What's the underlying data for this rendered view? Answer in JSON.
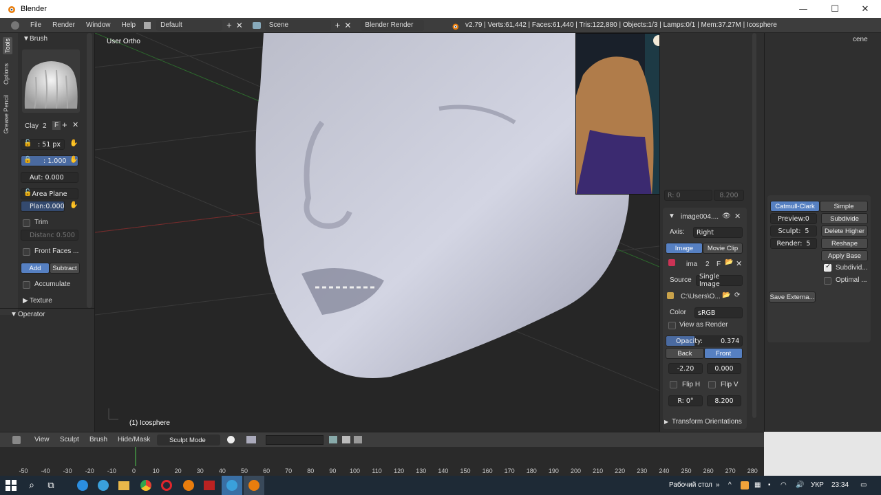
{
  "window": {
    "title": "Blender",
    "minimize": "—",
    "maximize": "☐",
    "close": "✕"
  },
  "infobar": {
    "menus": [
      "File",
      "Render",
      "Window",
      "Help"
    ],
    "layout": "Default",
    "scene": "Scene",
    "engine": "Blender Render",
    "stats": "v2.79 | Verts:61,442 | Faces:61,440 | Tris:122,880 | Objects:1/3 | Lamps:0/1 | Mem:37.27M | Icosphere"
  },
  "toolshelf": {
    "tabs": [
      "Tools",
      "Options",
      "Grease Pencil"
    ],
    "brush_header": "Brush",
    "brush_name": "Clay",
    "brush_users": "2",
    "brush_fake": "F",
    "radius": ": 51 px",
    "strength": ": 1.000",
    "autosmooth": "Aut: 0.000",
    "sculpt_plane": "Area Plane",
    "plane_offset": "Plan:0.000",
    "trim": "Trim",
    "distance": "Distanc 0.500",
    "front_faces": "Front Faces ...",
    "add": "Add",
    "subtract": "Subtract",
    "accumulate": "Accumulate",
    "texture": "Texture",
    "operator": "Operator"
  },
  "viewport": {
    "view_label": "User Ortho",
    "object_label": "(1) Icosphere"
  },
  "props": {
    "image_name": "image004....",
    "axis_label": "Axis:",
    "axis_value": "Right",
    "image_tab": "Image",
    "movieclip_tab": "Movie Clip",
    "image_short": "ima",
    "image_users": "2",
    "image_fake": "F",
    "source_label": "Source",
    "source_value": "Single Image",
    "path": "C:\\Users\\O...",
    "color_label": "Color",
    "color_value": "sRGB",
    "view_as_render": "View as Render",
    "opacity_label": "Opacity:",
    "opacity_value": "0.374",
    "back": "Back",
    "front": "Front",
    "offset_x": "-2.20",
    "offset_y": "0.000",
    "flip_h": "Flip H",
    "flip_v": "Flip V",
    "rotation": "R: 0°",
    "size": "8.200",
    "partial_r": "R: 0",
    "partial_size": "8.200",
    "transform_orientations": "Transform Orientations"
  },
  "modifier": {
    "catmull": "Catmull-Clark",
    "simple": "Simple",
    "preview": "Preview:0",
    "subdivide": "Subdivide",
    "sculpt": "Sculpt:",
    "sculpt_value": "5",
    "delete_higher": "Delete Higher",
    "render": "Render:",
    "render_value": "5",
    "reshape": "Reshape",
    "apply_base": "Apply Base",
    "subdivide_uvs": "Subdivid...",
    "optimal_display": "Optimal ...",
    "save_external": "Save Externa...",
    "scene_tab": "cene"
  },
  "vheader": {
    "view": "View",
    "sculpt": "Sculpt",
    "brush": "Brush",
    "hide_mask": "Hide/Mask",
    "mode": "Sculpt Mode"
  },
  "timeline": {
    "ticks": [
      "-50",
      "-40",
      "-30",
      "-20",
      "-10",
      "0",
      "10",
      "20",
      "30",
      "40",
      "50",
      "60",
      "70",
      "80",
      "90",
      "100",
      "110",
      "120",
      "130",
      "140",
      "150",
      "160",
      "170",
      "180",
      "190",
      "200",
      "210",
      "220",
      "230",
      "240",
      "250",
      "260",
      "270",
      "280"
    ]
  },
  "taskbar": {
    "desktop": "Рабочий стол",
    "lang": "УКР",
    "time": "23:34"
  },
  "colors": {
    "accent": "#5680c2",
    "panel": "#2f2f2f",
    "viewport_bg": "#262626",
    "mesh": "#c9cbd8"
  }
}
